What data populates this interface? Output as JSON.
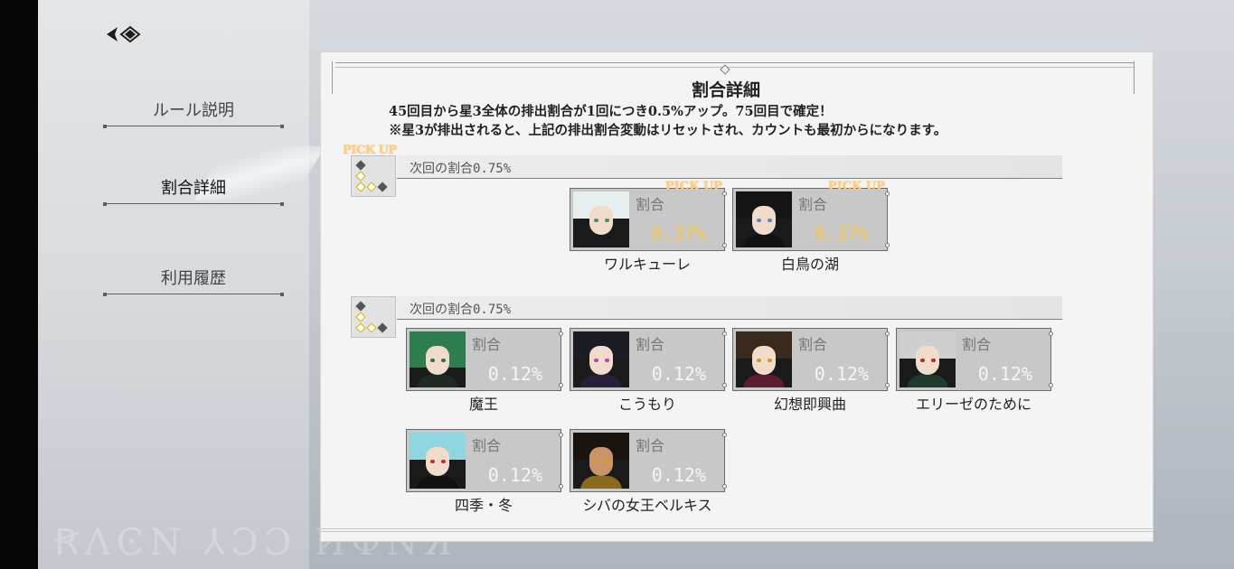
{
  "sidebar": {
    "back_icon": "back-arrow-icon",
    "items": [
      {
        "label": "ルール説明",
        "active": false
      },
      {
        "label": "割合詳細",
        "active": true
      },
      {
        "label": "利用履歴",
        "active": false
      }
    ]
  },
  "panel": {
    "title": "割合詳細",
    "notice_line1": "45回目から星3全体の排出割合が1回につき0.5%アップ。75回目で確定！",
    "notice_line2": "※星3が排出されると、上記の排出割合変動はリセットされ、カウントも最初からになります。"
  },
  "groups": [
    {
      "pickup_label": "PICK UP",
      "label": "次回の割合0.75%",
      "cards": [
        {
          "label": "割合",
          "rate": "0.37%",
          "name": "ワルキューレ",
          "pickup": "PICK UP"
        },
        {
          "label": "割合",
          "rate": "0.37%",
          "name": "白鳥の湖",
          "pickup": "PICK UP"
        }
      ]
    },
    {
      "label": "次回の割合0.75%",
      "cards": [
        {
          "label": "割合",
          "rate": "0.12%",
          "name": "魔王"
        },
        {
          "label": "割合",
          "rate": "0.12%",
          "name": "こうもり"
        },
        {
          "label": "割合",
          "rate": "0.12%",
          "name": "幻想即興曲"
        },
        {
          "label": "割合",
          "rate": "0.12%",
          "name": "エリーゼのために"
        },
        {
          "label": "割合",
          "rate": "0.12%",
          "name": "四季・冬"
        },
        {
          "label": "割合",
          "rate": "0.12%",
          "name": "シバの女王ベルキス"
        }
      ]
    }
  ],
  "colors": {
    "pickup_rate": "#f3c64a",
    "normal_rate": "#f5f5f5",
    "pickup_tag": "#ffcc80",
    "card_bg": "#c8c8c8"
  }
}
